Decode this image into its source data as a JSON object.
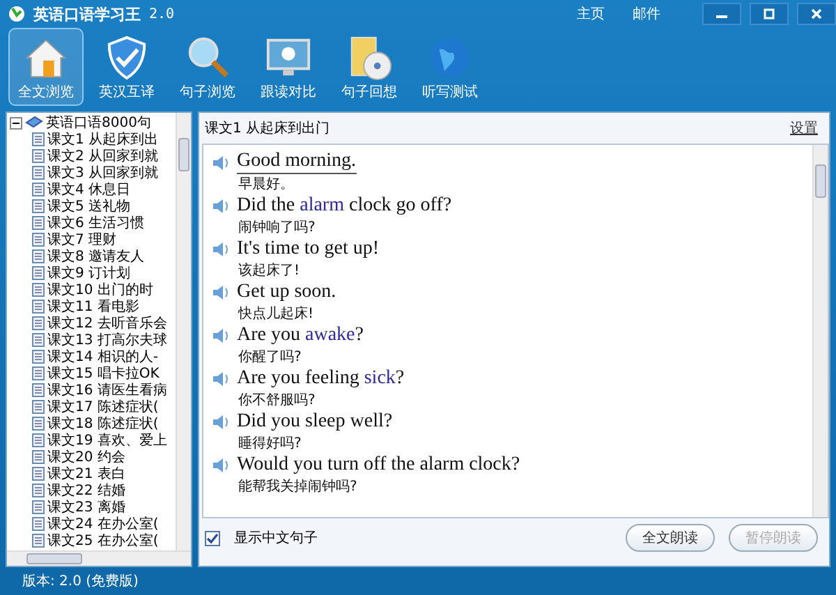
{
  "window": {
    "title": "英语口语学习王",
    "version": "2.0",
    "links": [
      "主页",
      "邮件"
    ]
  },
  "toolbar": [
    {
      "label": "全文浏览",
      "selected": true,
      "kind": "house"
    },
    {
      "label": "英汉互译",
      "selected": false,
      "kind": "shield"
    },
    {
      "label": "句子浏览",
      "selected": false,
      "kind": "magnifier"
    },
    {
      "label": "跟读对比",
      "selected": false,
      "kind": "monitor"
    },
    {
      "label": "句子回想",
      "selected": false,
      "kind": "disc"
    },
    {
      "label": "听写测试",
      "selected": false,
      "kind": "globe"
    }
  ],
  "tree": {
    "root": "英语口语8000句",
    "expanded": true,
    "children": [
      {
        "label": "课文1 从起床到出"
      },
      {
        "label": "课文2 从回家到就"
      },
      {
        "label": "课文3 从回家到就"
      },
      {
        "label": "课文4 休息日"
      },
      {
        "label": "课文5 送礼物"
      },
      {
        "label": "课文6 生活习惯"
      },
      {
        "label": "课文7 理财"
      },
      {
        "label": "课文8 邀请友人"
      },
      {
        "label": "课文9 订计划"
      },
      {
        "label": "课文10 出门的时"
      },
      {
        "label": "课文11 看电影"
      },
      {
        "label": "课文12 去听音乐会"
      },
      {
        "label": "课文13 打高尔夫球"
      },
      {
        "label": "课文14 相识的人-"
      },
      {
        "label": "课文15 唱卡拉OK"
      },
      {
        "label": "课文16 请医生看病"
      },
      {
        "label": "课文17 陈述症状("
      },
      {
        "label": "课文18 陈述症状("
      },
      {
        "label": "课文19 喜欢、爱上"
      },
      {
        "label": "课文20 约会"
      },
      {
        "label": "课文21 表白"
      },
      {
        "label": "课文22 结婚"
      },
      {
        "label": "课文23 离婚"
      },
      {
        "label": "课文24 在办公室("
      },
      {
        "label": "课文25 在办公室("
      }
    ]
  },
  "lesson": {
    "title": "课文1 从起床到出门",
    "settings_link": "设置",
    "sentences": [
      {
        "selected": true,
        "english": [
          {
            "text": "Good morning.",
            "highlight": false
          }
        ],
        "chinese": "早晨好。"
      },
      {
        "selected": false,
        "english": [
          {
            "text": "Did the ",
            "highlight": false
          },
          {
            "text": "alarm",
            "highlight": true
          },
          {
            "text": " clock go off?",
            "highlight": false
          }
        ],
        "chinese": "闹钟响了吗?"
      },
      {
        "selected": false,
        "english": [
          {
            "text": "It's time to get up!",
            "highlight": false
          }
        ],
        "chinese": "该起床了!"
      },
      {
        "selected": false,
        "english": [
          {
            "text": "Get up soon.",
            "highlight": false
          }
        ],
        "chinese": "快点儿起床!"
      },
      {
        "selected": false,
        "english": [
          {
            "text": "Are you ",
            "highlight": false
          },
          {
            "text": "awake",
            "highlight": true
          },
          {
            "text": "?",
            "highlight": false
          }
        ],
        "chinese": "你醒了吗?"
      },
      {
        "selected": false,
        "english": [
          {
            "text": "Are you feeling ",
            "highlight": false
          },
          {
            "text": "sick",
            "highlight": true
          },
          {
            "text": "?",
            "highlight": false
          }
        ],
        "chinese": "你不舒服吗?"
      },
      {
        "selected": false,
        "english": [
          {
            "text": "Did you sleep well?",
            "highlight": false
          }
        ],
        "chinese": "睡得好吗?"
      },
      {
        "selected": false,
        "english": [
          {
            "text": "Would you turn off the alarm clock?",
            "highlight": false
          }
        ],
        "chinese": "能帮我关掉闹钟吗?"
      }
    ],
    "show_chinese": {
      "label": "显示中文句子",
      "checked": true
    },
    "buttons": [
      {
        "label": "全文朗读",
        "disabled": false
      },
      {
        "label": "暂停朗读",
        "disabled": true
      }
    ]
  },
  "status_bar": "版本: 2.0 (免费版)"
}
